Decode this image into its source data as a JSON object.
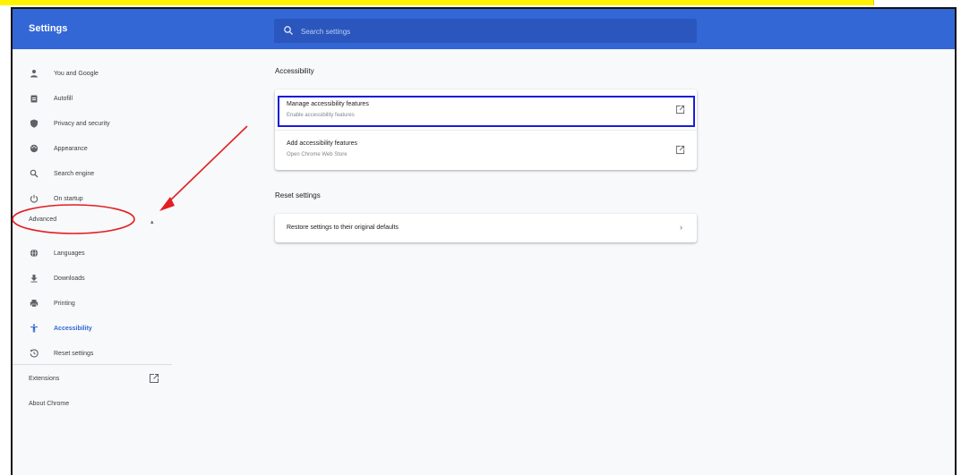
{
  "header": {
    "title": "Settings",
    "search_placeholder": "Search settings"
  },
  "sidebar": {
    "items": [
      {
        "label": "You and Google",
        "icon": "person-icon"
      },
      {
        "label": "Autofill",
        "icon": "clipboard-icon"
      },
      {
        "label": "Privacy and security",
        "icon": "shield-icon"
      },
      {
        "label": "Appearance",
        "icon": "palette-icon"
      },
      {
        "label": "Search engine",
        "icon": "search-icon"
      },
      {
        "label": "On startup",
        "icon": "power-icon"
      }
    ],
    "advanced_label": "Advanced",
    "advanced_items": [
      {
        "label": "Languages",
        "icon": "globe-icon"
      },
      {
        "label": "Downloads",
        "icon": "download-icon"
      },
      {
        "label": "Printing",
        "icon": "printer-icon"
      },
      {
        "label": "Accessibility",
        "icon": "accessibility-icon"
      },
      {
        "label": "Reset settings",
        "icon": "reset-icon"
      }
    ],
    "extensions_label": "Extensions",
    "about_label": "About Chrome"
  },
  "main": {
    "accessibility": {
      "title": "Accessibility",
      "rows": [
        {
          "title": "Manage accessibility features",
          "subtitle": "Enable accessibility features"
        },
        {
          "title": "Add accessibility features",
          "subtitle": "Open Chrome Web Store"
        }
      ]
    },
    "reset": {
      "title": "Reset settings",
      "row_title": "Restore settings to their original defaults"
    }
  },
  "colors": {
    "brand": "#3367d6",
    "highlight_box": "#1c1cd8",
    "annotation_red": "#e31e24",
    "top_strip": "#fff200"
  }
}
